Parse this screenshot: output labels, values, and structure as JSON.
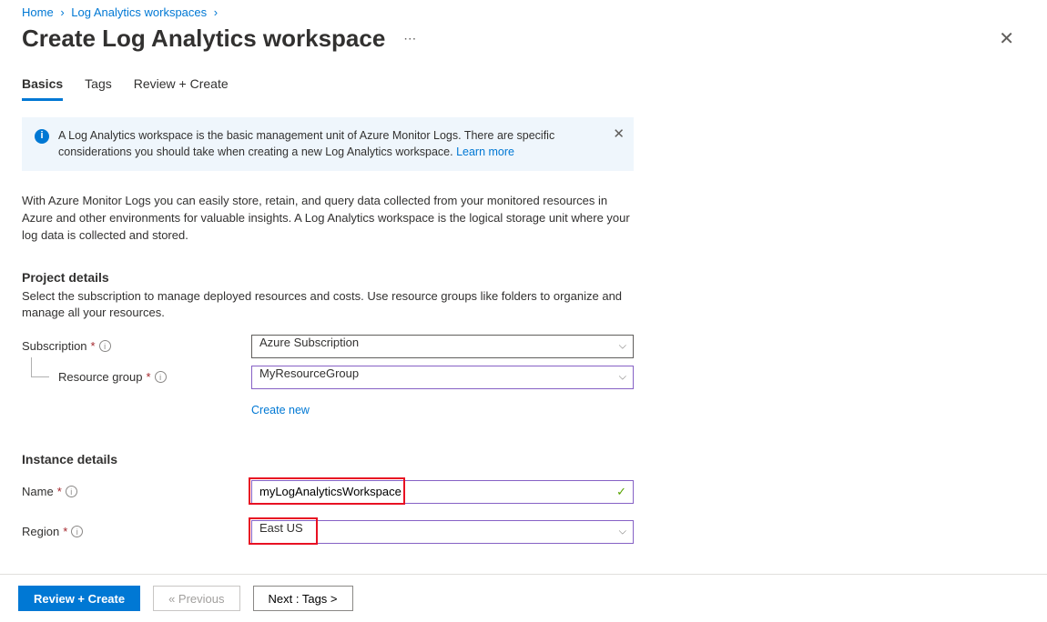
{
  "breadcrumb": {
    "home": "Home",
    "parent": "Log Analytics workspaces"
  },
  "page_title": "Create Log Analytics workspace",
  "tabs": {
    "basics": "Basics",
    "tags": "Tags",
    "review": "Review + Create"
  },
  "infobox": {
    "text": "A Log Analytics workspace is the basic management unit of Azure Monitor Logs. There are specific considerations you should take when creating a new Log Analytics workspace. ",
    "learn_more": "Learn more"
  },
  "description": "With Azure Monitor Logs you can easily store, retain, and query data collected from your monitored resources in Azure and other environments for valuable insights. A Log Analytics workspace is the logical storage unit where your log data is collected and stored.",
  "project": {
    "title": "Project details",
    "sub": "Select the subscription to manage deployed resources and costs. Use resource groups like folders to organize and manage all your resources.",
    "subscription_label": "Subscription",
    "subscription_value": "Azure Subscription",
    "rg_label": "Resource group",
    "rg_value": "MyResourceGroup",
    "create_new": "Create new"
  },
  "instance": {
    "title": "Instance details",
    "name_label": "Name",
    "name_value": "myLogAnalyticsWorkspace",
    "region_label": "Region",
    "region_value": "East US"
  },
  "footer": {
    "review": "Review + Create",
    "previous": "« Previous",
    "next": "Next : Tags >"
  }
}
